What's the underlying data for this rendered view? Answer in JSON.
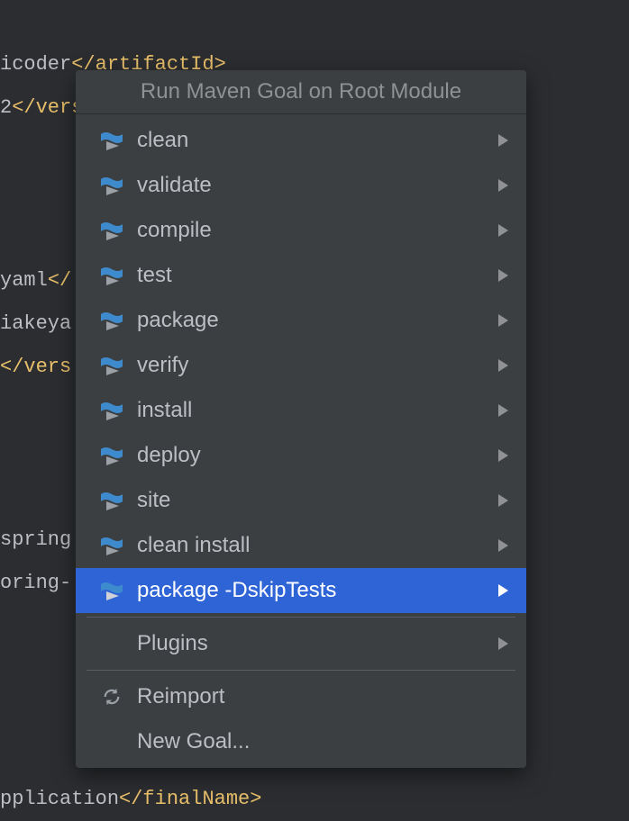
{
  "code_lines": [
    {
      "pre": "icoder",
      "tag": "</artifactId>"
    },
    {
      "pre": "2",
      "tag": "</version>"
    },
    {
      "pre": "",
      "tag": ""
    },
    {
      "pre": "",
      "tag": ""
    },
    {
      "pre": "yaml",
      "tag": "</"
    },
    {
      "pre": "",
      "tag": ""
    },
    {
      "pre": "iakeya",
      "tag": ""
    },
    {
      "tagonly": "</vers"
    },
    {
      "pre": "",
      "tag": ""
    },
    {
      "pre": "",
      "tag": ""
    },
    {
      "pre": "spring",
      "tag": ""
    },
    {
      "pre": "",
      "tag": ""
    },
    {
      "pre": "oring-",
      "tag": ""
    },
    {
      "pre": "",
      "tag": ""
    },
    {
      "pre": "",
      "tag": ""
    },
    {
      "pre": "",
      "tag": ""
    },
    {
      "pre": "",
      "tag": ""
    },
    {
      "pre": "pplication",
      "tag": "</finalName>"
    }
  ],
  "menu": {
    "title": "Run Maven Goal on Root Module",
    "goals": [
      {
        "label": "clean",
        "hasArrow": true,
        "icon": "maven"
      },
      {
        "label": "validate",
        "hasArrow": true,
        "icon": "maven"
      },
      {
        "label": "compile",
        "hasArrow": true,
        "icon": "maven"
      },
      {
        "label": "test",
        "hasArrow": true,
        "icon": "maven"
      },
      {
        "label": "package",
        "hasArrow": true,
        "icon": "maven"
      },
      {
        "label": "verify",
        "hasArrow": true,
        "icon": "maven"
      },
      {
        "label": "install",
        "hasArrow": true,
        "icon": "maven"
      },
      {
        "label": "deploy",
        "hasArrow": true,
        "icon": "maven"
      },
      {
        "label": "site",
        "hasArrow": true,
        "icon": "maven"
      },
      {
        "label": "clean install",
        "hasArrow": true,
        "icon": "maven"
      },
      {
        "label": "package -DskipTests",
        "hasArrow": true,
        "icon": "maven",
        "selected": true
      }
    ],
    "plugins_label": "Plugins",
    "reimport_label": "Reimport",
    "newgoal_label": "New Goal..."
  }
}
